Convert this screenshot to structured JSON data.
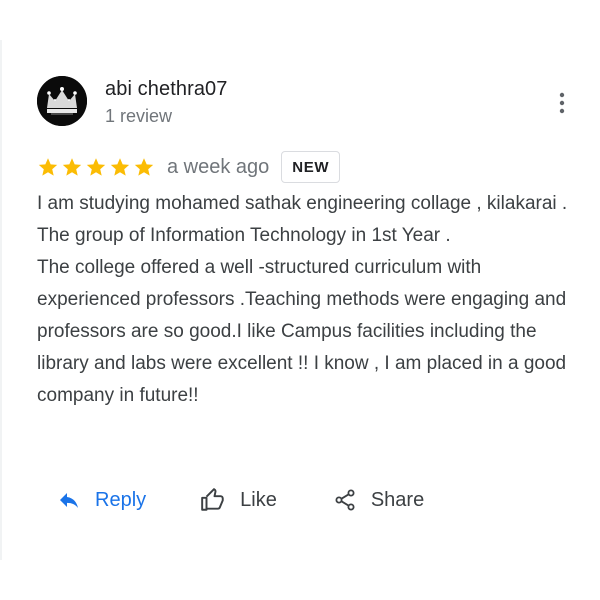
{
  "review": {
    "author": {
      "name": "abi chethra07",
      "review_count": "1 review",
      "avatar_icon": "crown-icon"
    },
    "rating": {
      "stars_filled": 5,
      "stars_total": 5,
      "star_color": "#fbbc04"
    },
    "time_ago": "a week ago",
    "badge": "NEW",
    "text": {
      "paragraph_1": "I am studying mohamed sathak engineering collage , kilakarai . The group of Information Technology in 1st Year .",
      "paragraph_2": "The college offered a well -structured curriculum with experienced professors .Teaching methods were engaging and professors are so good.I like Campus facilities including the library and labs were excellent !! I know , I am placed in a good company in future!!"
    },
    "more_icon": "more-vert-icon"
  },
  "actions": {
    "reply": {
      "label": "Reply",
      "icon": "reply-icon",
      "color": "#1a73e8"
    },
    "like": {
      "label": "Like",
      "icon": "thumb-up-icon"
    },
    "share": {
      "label": "Share",
      "icon": "share-icon"
    }
  }
}
